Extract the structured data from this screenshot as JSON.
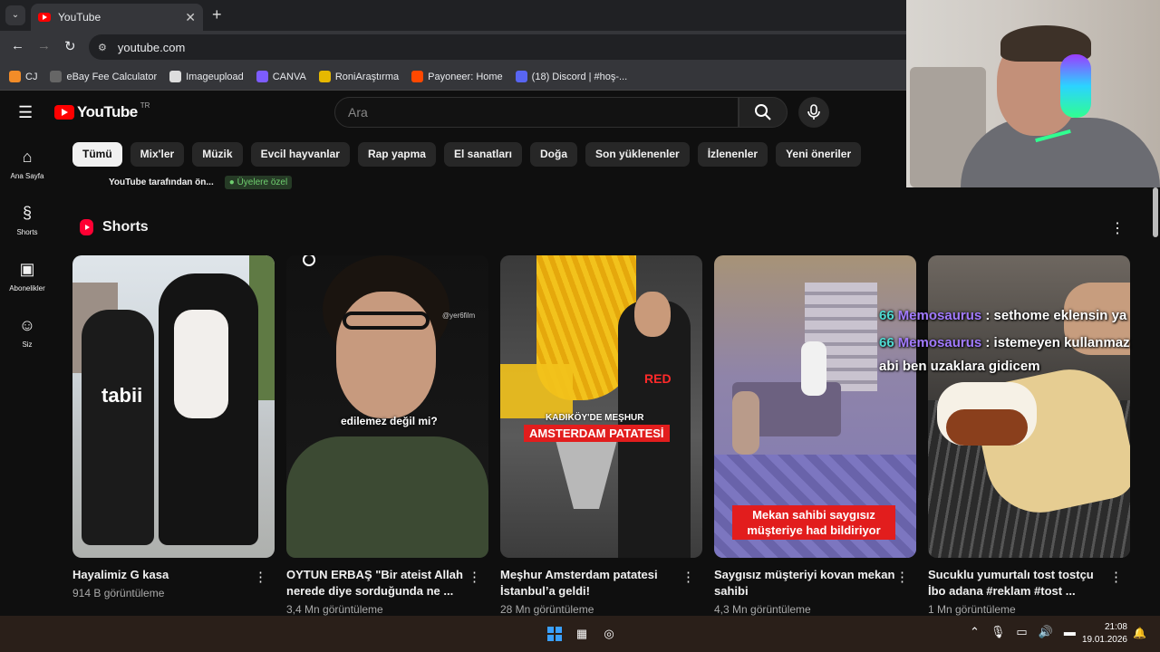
{
  "browser": {
    "tab_title": "YouTube",
    "url": "youtube.com",
    "bookmarks": [
      {
        "label": "CJ",
        "color": "#f28c28"
      },
      {
        "label": "eBay Fee Calculator",
        "color": "#666666"
      },
      {
        "label": "Imageupload",
        "color": "#dddddd"
      },
      {
        "label": "CANVA",
        "color": "#7d5cff"
      },
      {
        "label": "RoniAraştırma",
        "color": "#e6b800"
      },
      {
        "label": "Payoneer: Home",
        "color": "#ff4800"
      },
      {
        "label": "(18) Discord | #hoş-...",
        "color": "#5865f2"
      }
    ]
  },
  "youtube": {
    "logo_text": "YouTube",
    "country_code": "TR",
    "search_placeholder": "Ara",
    "sidebar": [
      {
        "label": "Ana Sayfa",
        "icon": "home-icon",
        "glyph": "⌂"
      },
      {
        "label": "Shorts",
        "icon": "shorts-icon",
        "glyph": "§"
      },
      {
        "label": "Abonelikler",
        "icon": "subscriptions-icon",
        "glyph": "▣"
      },
      {
        "label": "Siz",
        "icon": "user-icon",
        "glyph": "☺"
      }
    ],
    "chips": [
      "Tümü",
      "Mix'ler",
      "Müzik",
      "Evcil hayvanlar",
      "Rap yapma",
      "El sanatları",
      "Doğa",
      "Son yüklenenler",
      "İzlenenler",
      "Yeni öneriler"
    ],
    "active_chip": "Tümü",
    "subrow_text": "YouTube tarafından ön...",
    "members_badge": "Üyelere özel",
    "shorts_title": "Shorts",
    "shorts": [
      {
        "title": "Hayalimiz G kasa",
        "views": "914 B görüntüleme",
        "overlay": "tabii"
      },
      {
        "title": "OYTUN ERBAŞ \"Bir ateist Allah nerede diye sorduğunda ne ...",
        "views": "3,4 Mn görüntüleme",
        "overlay": "edilemez değil mi?",
        "handle": "@yer6film"
      },
      {
        "title": "Meşhur Amsterdam patatesi İstanbul’a geldi!",
        "views": "28 Mn görüntüleme",
        "overlay": "KADIKÖY'DE MEŞHUR",
        "overlay2": "AMSTERDAM PATATESİ",
        "shirt": "RED"
      },
      {
        "title": "Saygısız müşteriyi kovan mekan sahibi",
        "views": "4,3 Mn görüntüleme",
        "overlay": "Mekan sahibi saygısız",
        "overlay2": "müşteriye had bildiriyor"
      },
      {
        "title": "Sucuklu yumurtalı tost tostçu İbo adana #reklam #tost ...",
        "views": "1 Mn görüntüleme"
      }
    ]
  },
  "chat": [
    {
      "user": "Memosaurus",
      "message": ": sethome eklensin ya"
    },
    {
      "user": "Memosaurus",
      "message": ": istemeyen kullanmaz"
    },
    {
      "user": "",
      "message": "abi ben uzaklara gidicem"
    }
  ],
  "taskbar": {
    "time": "21:08",
    "date": "19.01.2026"
  }
}
